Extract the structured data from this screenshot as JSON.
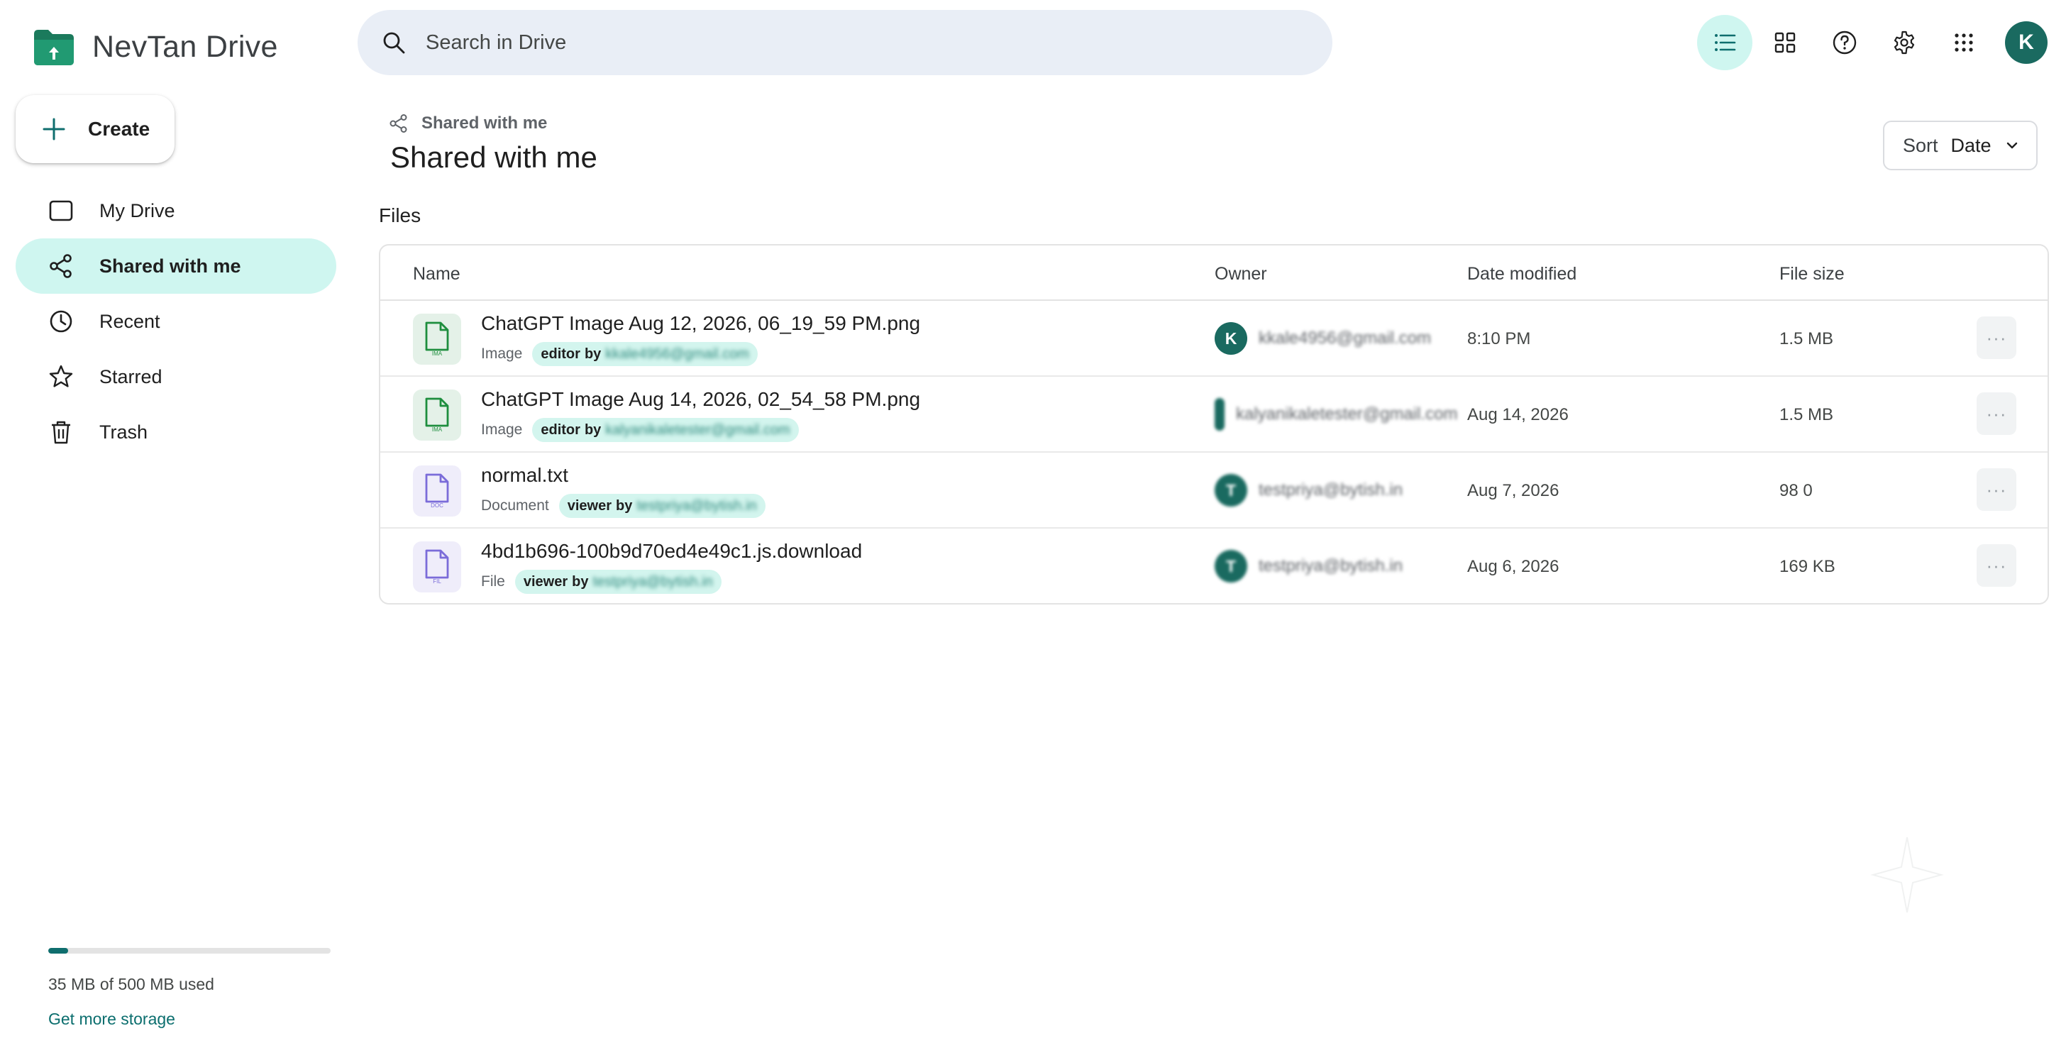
{
  "app": {
    "name": "NevTan Drive"
  },
  "sidebar": {
    "create_label": "Create",
    "items": [
      {
        "label": "My Drive",
        "icon": "drive-icon",
        "active": false
      },
      {
        "label": "Shared with me",
        "icon": "share-icon",
        "active": true
      },
      {
        "label": "Recent",
        "icon": "clock-icon",
        "active": false
      },
      {
        "label": "Starred",
        "icon": "star-icon",
        "active": false
      },
      {
        "label": "Trash",
        "icon": "trash-icon",
        "active": false
      }
    ],
    "storage": {
      "used_fraction": 0.07,
      "text": "35 MB of 500 MB used",
      "link": "Get more storage"
    }
  },
  "search": {
    "placeholder": "Search in Drive"
  },
  "topbar": {
    "avatar_initial": "K"
  },
  "main": {
    "breadcrumb": "Shared with me",
    "title": "Shared with me",
    "sort_label": "Sort",
    "sort_value": "Date",
    "section_label": "Files",
    "columns": {
      "name": "Name",
      "owner": "Owner",
      "date": "Date modified",
      "size": "File size"
    },
    "files": [
      {
        "name": "ChatGPT Image Aug 12, 2026, 06_19_59 PM.png",
        "type": "Image",
        "role": "editor",
        "by": "by",
        "shared_by": "kkale4956@gmail.com",
        "owner_initial": "K",
        "owner_email": "kkale4956@gmail.com",
        "date": "8:10 PM",
        "size": "1.5 MB",
        "more": "···",
        "icon_color": "#1e8e3e",
        "icon_tag": "IMA"
      },
      {
        "name": "ChatGPT Image Aug 14, 2026, 02_54_58 PM.png",
        "type": "Image",
        "role": "editor",
        "by": "by",
        "shared_by": "kalyanikaletester@gmail.com",
        "owner_initial": "",
        "owner_email": "kalyanikaletester@gmail.com",
        "date": "Aug 14, 2026",
        "size": "1.5 MB",
        "more": "···",
        "icon_color": "#1e8e3e",
        "icon_tag": "IMA"
      },
      {
        "name": "normal.txt",
        "type": "Document",
        "role": "viewer",
        "by": "by",
        "shared_by": "testpriya@bytish.in",
        "owner_initial": "T",
        "owner_email": "testpriya@bytish.in",
        "date": "Aug 7, 2026",
        "size": "98 0",
        "more": "···",
        "icon_color": "#7b6cd9",
        "icon_tag": "DOC"
      },
      {
        "name": "4bd1b696-100b9d70ed4e49c1.js.download",
        "type": "File",
        "role": "viewer",
        "by": "by",
        "shared_by": "testpriya@bytish.in",
        "owner_initial": "T",
        "owner_email": "testpriya@bytish.in",
        "date": "Aug 6, 2026",
        "size": "169 KB",
        "more": "···",
        "icon_color": "#7b6cd9",
        "icon_tag": "FIL"
      }
    ]
  },
  "colors": {
    "accent": "#0f6e6e",
    "active_bg": "#cff6f0",
    "pill_bg": "#d3f5ee",
    "avatar": "#1a6a60"
  }
}
